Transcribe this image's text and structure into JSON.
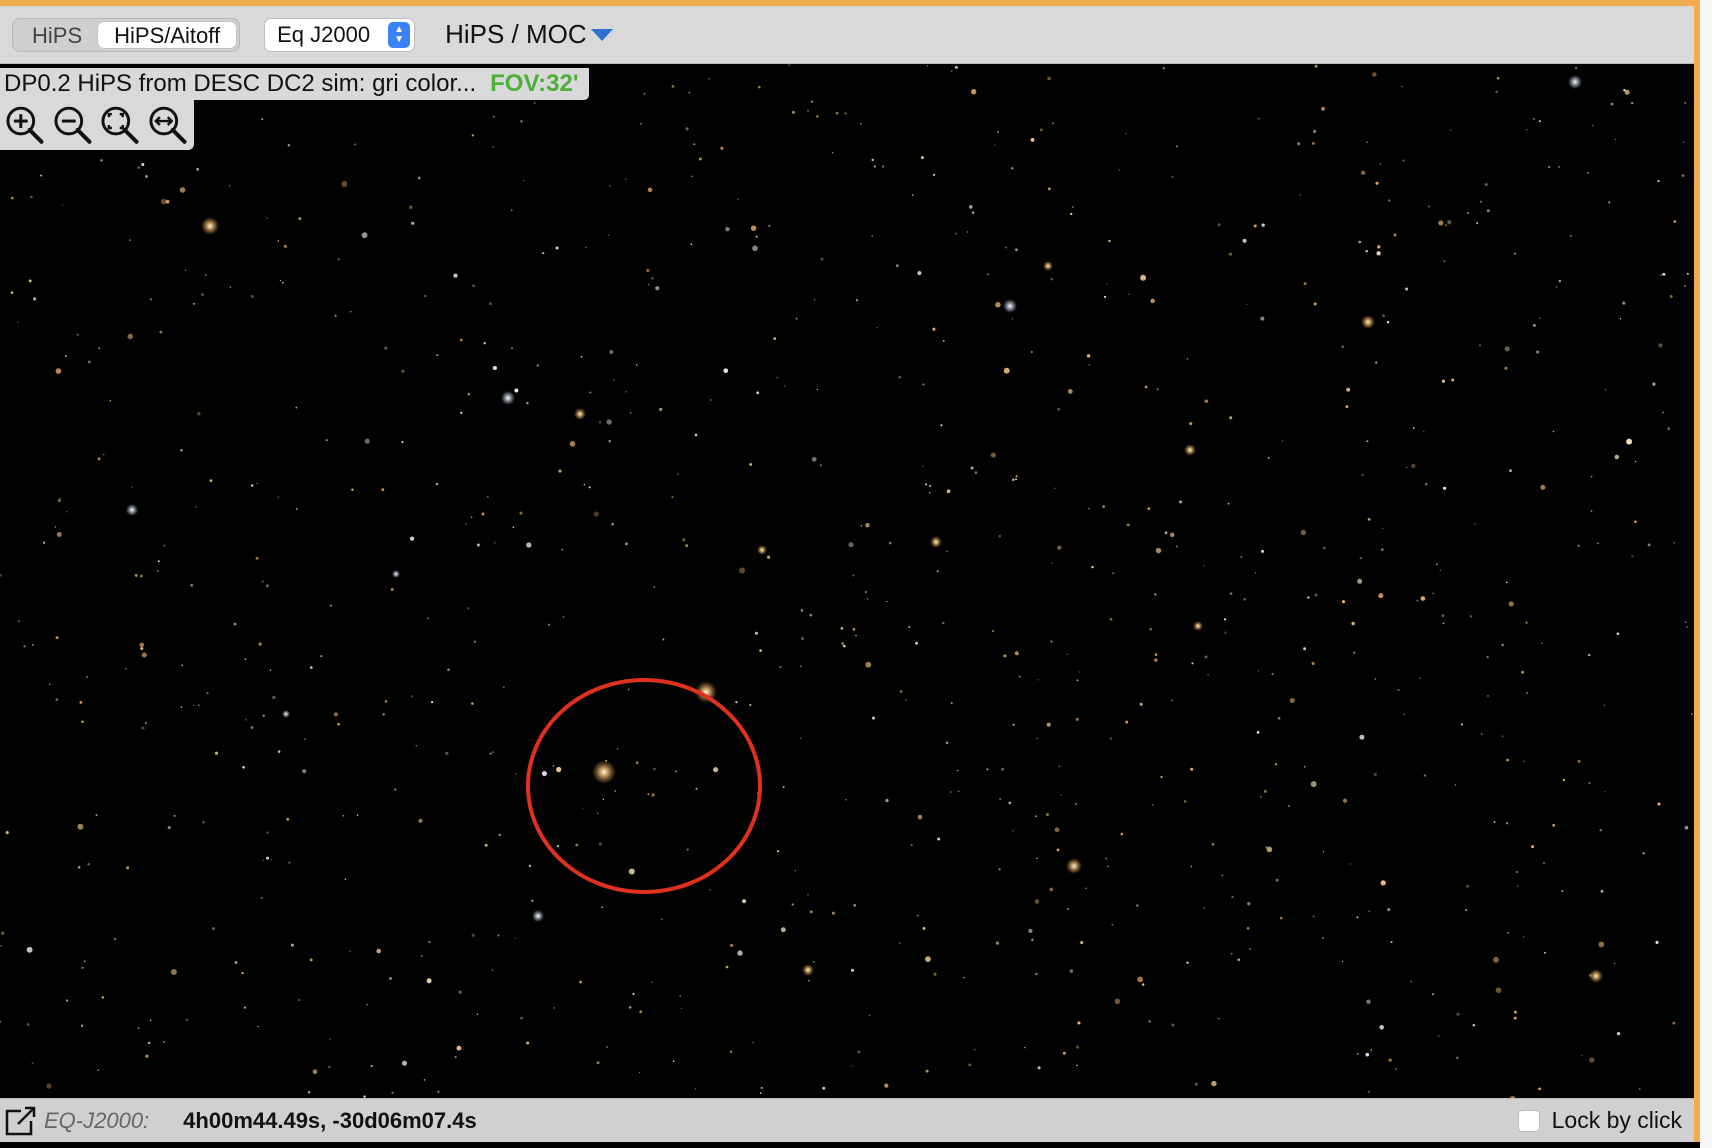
{
  "toolbar": {
    "projection_tabs": [
      {
        "label": "HiPS",
        "active": false
      },
      {
        "label": "HiPS/Aitoff",
        "active": true
      }
    ],
    "coord_system": "Eq J2000",
    "layers_menu": "HiPS / MOC"
  },
  "viewer": {
    "title": "DP0.2 HiPS from DESC DC2 sim: gri color...",
    "fov": "FOV:32'"
  },
  "zoom_tools": [
    "zoom-in-icon",
    "zoom-out-icon",
    "zoom-fit-icon",
    "zoom-fill-icon"
  ],
  "status": {
    "coord_label": "EQ-J2000:",
    "coord_value": "4h00m44.49s, -30d06m07.4s",
    "lock_label": "Lock by click"
  },
  "colors": {
    "frame_border": "#f0ad4e",
    "fov_text": "#4caf38",
    "marker_circle": "#e0301e",
    "menu_arrow": "#2f6fd0"
  }
}
